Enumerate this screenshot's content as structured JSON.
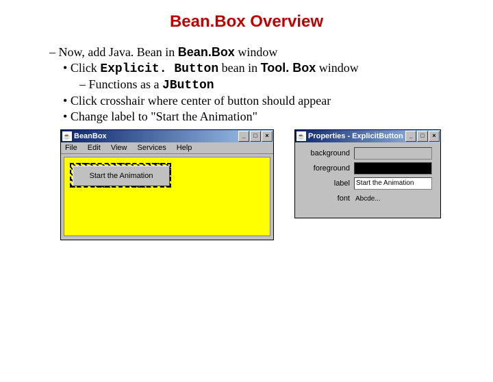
{
  "title": "Bean.Box Overview",
  "bullets": {
    "l1": "Now, add Java. Bean in ",
    "l1b": "Bean.Box",
    "l1c": " window",
    "l2a": "Click ",
    "l2b": "Explicit. Button",
    "l2c": " bean in ",
    "l2d": "Tool. Box",
    "l2e": " window",
    "l3a": "Functions as a ",
    "l3b": "JButton",
    "l4": "Click crosshair where center of button should appear",
    "l5": "Change label to \"Start the Animation\""
  },
  "beanbox": {
    "title": "BeanBox",
    "menus": [
      "File",
      "Edit",
      "View",
      "Services",
      "Help"
    ],
    "button_label": "Start the Animation"
  },
  "properties": {
    "title": "Properties - ExplicitButton",
    "rows": {
      "background": "background",
      "foreground": "foreground",
      "label": "label",
      "label_value": "Start the Animation",
      "font": "font",
      "font_value": "Abcde..."
    }
  },
  "winbuttons": {
    "min": "_",
    "max": "□",
    "close": "×"
  }
}
